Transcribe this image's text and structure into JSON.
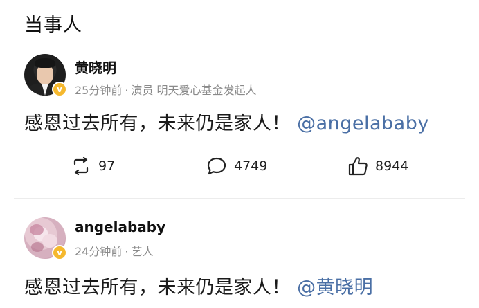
{
  "section": {
    "title": "当事人"
  },
  "posts": [
    {
      "username": "黄晓明",
      "time": "25分钟前",
      "separator": "·",
      "description": "演员 明天爱心基金发起人",
      "text": "感恩过去所有，未来仍是家人！",
      "mention": "@angelababy",
      "verified_badge": "v",
      "stats": {
        "reposts": "97",
        "comments": "4749",
        "likes": "8944"
      }
    },
    {
      "username": "angelababy",
      "time": "24分钟前",
      "separator": "·",
      "description": "艺人",
      "text": "感恩过去所有，未来仍是家人！",
      "mention": "@黄晓明",
      "verified_badge": "v"
    }
  ],
  "colors": {
    "mention": "#4a6fa5",
    "meta": "#8a8a8a",
    "badge": "#f5b82e"
  },
  "icons": {
    "repost": "repost-icon",
    "comment": "comment-icon",
    "like": "like-icon"
  }
}
